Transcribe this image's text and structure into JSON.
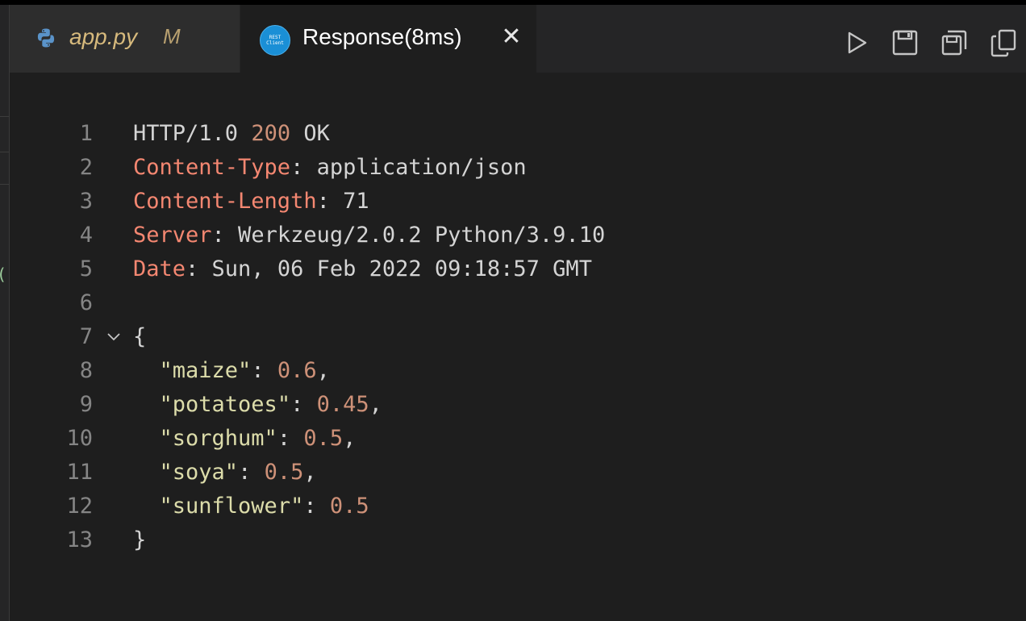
{
  "tabs": [
    {
      "title": "app.py",
      "status": "M",
      "icon": "python-icon",
      "active": false
    },
    {
      "title": "Response(8ms)",
      "icon": "rest-client-icon",
      "icon_text": [
        "REST",
        "Client"
      ],
      "active": true,
      "close": "✕"
    }
  ],
  "toolbar": {
    "buttons": [
      {
        "name": "run-icon"
      },
      {
        "name": "save-icon"
      },
      {
        "name": "save-all-icon"
      },
      {
        "name": "copy-icon"
      }
    ]
  },
  "editor": {
    "lines": [
      {
        "n": "1",
        "parts": [
          {
            "t": "HTTP/1.0 ",
            "c": "plain"
          },
          {
            "t": "200",
            "c": "status"
          },
          {
            "t": " OK",
            "c": "plain"
          }
        ]
      },
      {
        "n": "2",
        "parts": [
          {
            "t": "Content-Type",
            "c": "hk"
          },
          {
            "t": ": application/json",
            "c": "plain"
          }
        ]
      },
      {
        "n": "3",
        "parts": [
          {
            "t": "Content-Length",
            "c": "hk"
          },
          {
            "t": ": ",
            "c": "plain"
          },
          {
            "t": "71",
            "c": "plain"
          }
        ]
      },
      {
        "n": "4",
        "parts": [
          {
            "t": "Server",
            "c": "hk"
          },
          {
            "t": ": Werkzeug/2.0.2 Python/3.9.10",
            "c": "plain"
          }
        ]
      },
      {
        "n": "5",
        "parts": [
          {
            "t": "Date",
            "c": "hk"
          },
          {
            "t": ": Sun, 06 Feb 2022 09:18:57 GMT",
            "c": "plain"
          }
        ]
      },
      {
        "n": "6",
        "parts": []
      },
      {
        "n": "7",
        "fold": true,
        "parts": [
          {
            "t": "{",
            "c": "plain"
          }
        ]
      },
      {
        "n": "8",
        "parts": [
          {
            "t": "  ",
            "c": "plain"
          },
          {
            "t": "\"maize\"",
            "c": "key"
          },
          {
            "t": ": ",
            "c": "plain"
          },
          {
            "t": "0.6",
            "c": "num"
          },
          {
            "t": ",",
            "c": "plain"
          }
        ]
      },
      {
        "n": "9",
        "parts": [
          {
            "t": "  ",
            "c": "plain"
          },
          {
            "t": "\"potatoes\"",
            "c": "key"
          },
          {
            "t": ": ",
            "c": "plain"
          },
          {
            "t": "0.45",
            "c": "num"
          },
          {
            "t": ",",
            "c": "plain"
          }
        ]
      },
      {
        "n": "10",
        "parts": [
          {
            "t": "  ",
            "c": "plain"
          },
          {
            "t": "\"sorghum\"",
            "c": "key"
          },
          {
            "t": ": ",
            "c": "plain"
          },
          {
            "t": "0.5",
            "c": "num"
          },
          {
            "t": ",",
            "c": "plain"
          }
        ]
      },
      {
        "n": "11",
        "parts": [
          {
            "t": "  ",
            "c": "plain"
          },
          {
            "t": "\"soya\"",
            "c": "key"
          },
          {
            "t": ": ",
            "c": "plain"
          },
          {
            "t": "0.5",
            "c": "num"
          },
          {
            "t": ",",
            "c": "plain"
          }
        ]
      },
      {
        "n": "12",
        "parts": [
          {
            "t": "  ",
            "c": "plain"
          },
          {
            "t": "\"sunflower\"",
            "c": "key"
          },
          {
            "t": ": ",
            "c": "plain"
          },
          {
            "t": "0.5",
            "c": "num"
          }
        ]
      },
      {
        "n": "13",
        "parts": [
          {
            "t": "}",
            "c": "plain"
          }
        ]
      }
    ]
  },
  "colors": {
    "header_key": "#f48771",
    "json_key": "#dcdcaa",
    "number": "#ce9178",
    "text": "#d4d4d4",
    "line_number": "#858585"
  }
}
